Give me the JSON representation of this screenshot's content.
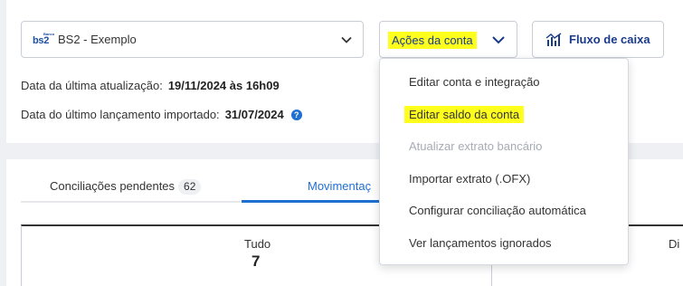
{
  "account": {
    "bank_logo": "bs2",
    "bank_logo_mini": "Banco",
    "name": "BS2 - Exemplo"
  },
  "actions_button": {
    "label": "Ações da conta"
  },
  "cashflow_button": {
    "label": "Fluxo de caixa"
  },
  "info": {
    "last_update_label": "Data da última atualização:",
    "last_update_value": "19/11/2024 às 16h09",
    "last_import_label": "Data do último lançamento importado:",
    "last_import_value": "31/07/2024",
    "help_icon": "?"
  },
  "tabs": [
    {
      "label": "Conciliações pendentes",
      "count": "62"
    },
    {
      "label": "Movimentaç"
    }
  ],
  "summary": {
    "all_label": "Tudo",
    "all_value": "7",
    "second_label": "Di"
  },
  "dropdown": {
    "items": [
      {
        "label": "Editar conta e integração",
        "state": "normal"
      },
      {
        "label": "Editar saldo da conta",
        "state": "highlighted"
      },
      {
        "label": "Atualizar extrato bancário",
        "state": "disabled"
      },
      {
        "label": "Importar extrato (.OFX)",
        "state": "normal"
      },
      {
        "label": "Configurar conciliação automática",
        "state": "normal"
      },
      {
        "label": "Ver lançamentos ignorados",
        "state": "normal"
      }
    ]
  },
  "colors": {
    "accent": "#1f6fd1",
    "highlight": "#ffff1e",
    "brand_text": "#1a3a8a"
  }
}
